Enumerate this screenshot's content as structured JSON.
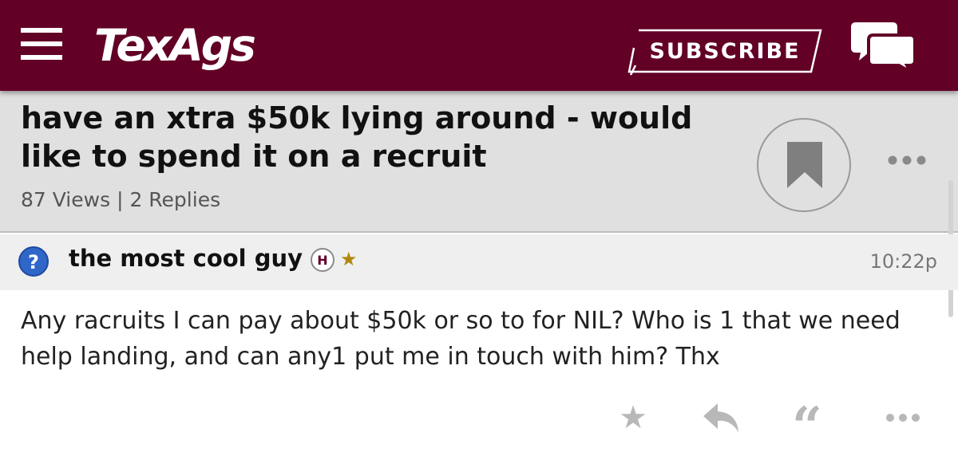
{
  "header": {
    "logo_text": "TexAgs",
    "subscribe_label": "SUBSCRIBE",
    "brand_color": "#620026"
  },
  "thread": {
    "title": "have an xtra $50k lying around - would like to spend it on a recruit",
    "views": "87 Views",
    "separator": "|",
    "replies": "2 Replies"
  },
  "post": {
    "username": "the most cool guy",
    "badge": "H",
    "time": "10:22p",
    "body": "Any racruits I can pay about $50k or so to for NIL? Who is 1 that we need help landing, and can any1 put me in touch with him? Thx"
  },
  "icons": {
    "menu": "hamburger-icon",
    "chat": "chat-bubbles-icon",
    "bookmark": "bookmark-icon",
    "more": "ellipsis-icon",
    "user": "question-mark-icon",
    "star": "star-icon",
    "reply": "reply-arrow-icon",
    "quote": "quote-icon"
  }
}
